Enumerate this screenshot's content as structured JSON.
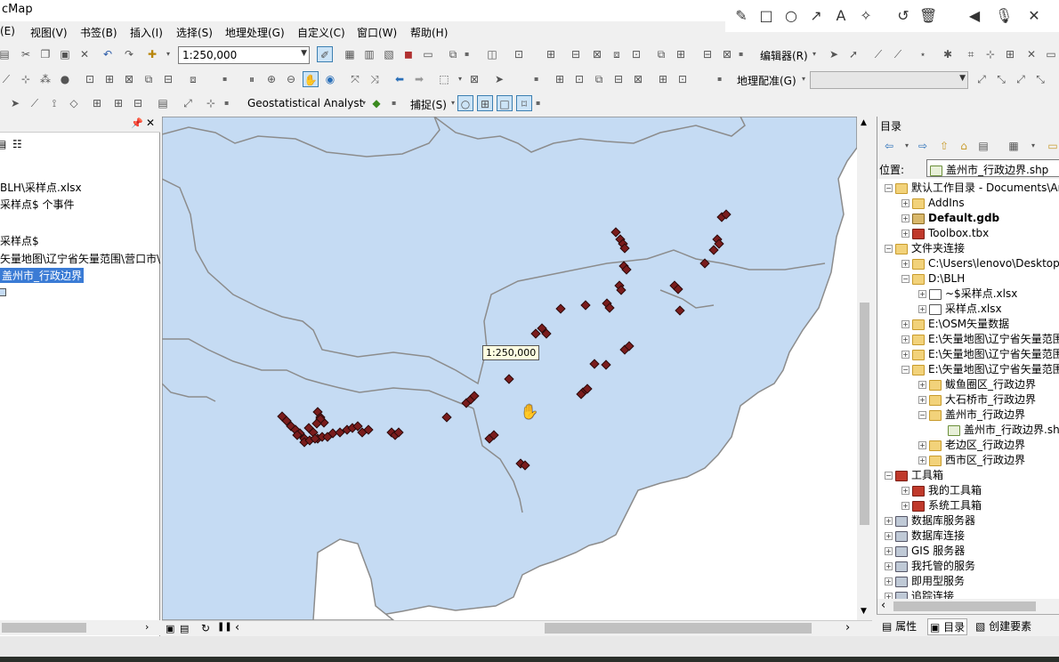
{
  "window": {
    "title": "cMap"
  },
  "menu": [
    "(E)",
    "视图(V)",
    "书签(B)",
    "插入(I)",
    "选择(S)",
    "地理处理(G)",
    "自定义(C)",
    "窗口(W)",
    "帮助(H)"
  ],
  "annotation_tools": [
    "pencil-icon",
    "rectangle-icon",
    "circle-icon",
    "arrow-icon",
    "text-icon",
    "magic-wand-icon",
    "undo-icon",
    "trash-icon",
    "speaker-icon",
    "microphone-icon",
    "close-icon"
  ],
  "toolbar": {
    "scale_value": "1:250,000",
    "editor_label": "编辑器(R)",
    "georef_label": "地理配准(G)",
    "geostat_label": "Geostatistical Analyst",
    "snap_label": "捕捉(S)"
  },
  "toc": {
    "lines": [
      "BLH\\采样点.xlsx",
      "采样点$ 个事件",
      "采样点$",
      "矢量地图\\辽宁省矢量范围\\营口市\\",
      "盖州市_行政边界"
    ]
  },
  "map": {
    "scale_tip": "1:250,000",
    "colors": {
      "fill": "#c5dbf3",
      "boundary": "#8c8c8c",
      "point": "#7a1c1c"
    }
  },
  "catalog": {
    "title": "目录",
    "location_label": "位置:",
    "location_value": "盖州市_行政边界.shp",
    "tree": [
      {
        "text": "默认工作目录 - Documents\\ArcGIS",
        "level": 0,
        "exp": "−",
        "icon": "folder",
        "bold": false
      },
      {
        "text": "AddIns",
        "level": 1,
        "exp": "+",
        "icon": "folder",
        "bold": false
      },
      {
        "text": "Default.gdb",
        "level": 1,
        "exp": "+",
        "icon": "db",
        "bold": true
      },
      {
        "text": "Toolbox.tbx",
        "level": 1,
        "exp": "+",
        "icon": "tbx",
        "bold": false
      },
      {
        "text": "文件夹连接",
        "level": 0,
        "exp": "−",
        "icon": "folder",
        "bold": false
      },
      {
        "text": "C:\\Users\\lenovo\\Desktop",
        "level": 1,
        "exp": "+",
        "icon": "folder",
        "bold": false
      },
      {
        "text": "D:\\BLH",
        "level": 1,
        "exp": "−",
        "icon": "folder",
        "bold": false
      },
      {
        "text": "~$采样点.xlsx",
        "level": 2,
        "exp": "+",
        "icon": "xls",
        "bold": false
      },
      {
        "text": "采样点.xlsx",
        "level": 2,
        "exp": "+",
        "icon": "xls",
        "bold": false
      },
      {
        "text": "E:\\OSM矢量数据",
        "level": 1,
        "exp": "+",
        "icon": "folder",
        "bold": false
      },
      {
        "text": "E:\\矢量地图\\辽宁省矢量范围",
        "level": 1,
        "exp": "+",
        "icon": "folder",
        "bold": false
      },
      {
        "text": "E:\\矢量地图\\辽宁省矢量范围",
        "level": 1,
        "exp": "+",
        "icon": "folder",
        "bold": false
      },
      {
        "text": "E:\\矢量地图\\辽宁省矢量范围",
        "level": 1,
        "exp": "−",
        "icon": "folder",
        "bold": false
      },
      {
        "text": "鲅鱼圈区_行政边界",
        "level": 2,
        "exp": "+",
        "icon": "folder",
        "bold": false
      },
      {
        "text": "大石桥市_行政边界",
        "level": 2,
        "exp": "+",
        "icon": "folder",
        "bold": false
      },
      {
        "text": "盖州市_行政边界",
        "level": 2,
        "exp": "−",
        "icon": "folder",
        "bold": false
      },
      {
        "text": "盖州市_行政边界.shp",
        "level": 3,
        "exp": "",
        "icon": "shp",
        "bold": false
      },
      {
        "text": "老边区_行政边界",
        "level": 2,
        "exp": "+",
        "icon": "folder",
        "bold": false
      },
      {
        "text": "西市区_行政边界",
        "level": 2,
        "exp": "+",
        "icon": "folder",
        "bold": false
      },
      {
        "text": "工具箱",
        "level": 0,
        "exp": "−",
        "icon": "tbx",
        "bold": false
      },
      {
        "text": "我的工具箱",
        "level": 1,
        "exp": "+",
        "icon": "tbx",
        "bold": false
      },
      {
        "text": "系统工具箱",
        "level": 1,
        "exp": "+",
        "icon": "tbx",
        "bold": false
      },
      {
        "text": "数据库服务器",
        "level": 0,
        "exp": "+",
        "icon": "srv",
        "bold": false
      },
      {
        "text": "数据库连接",
        "level": 0,
        "exp": "+",
        "icon": "srv",
        "bold": false
      },
      {
        "text": "GIS 服务器",
        "level": 0,
        "exp": "+",
        "icon": "srv",
        "bold": false
      },
      {
        "text": "我托管的服务",
        "level": 0,
        "exp": "+",
        "icon": "srv",
        "bold": false
      },
      {
        "text": "即用型服务",
        "level": 0,
        "exp": "+",
        "icon": "srv",
        "bold": false
      },
      {
        "text": "追踪连接",
        "level": 0,
        "exp": "+",
        "icon": "srv",
        "bold": false
      }
    ],
    "tabs": [
      "属性",
      "目录",
      "创建要素"
    ]
  }
}
